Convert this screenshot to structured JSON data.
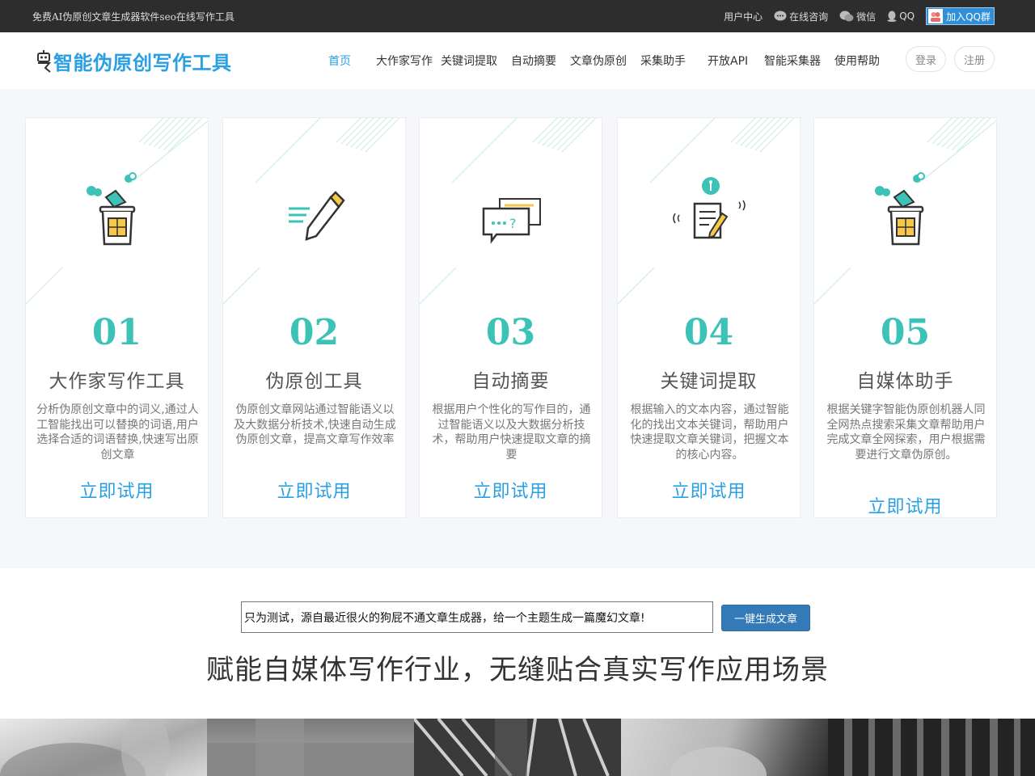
{
  "topbar": {
    "slogan": "免费AI伪原创文章生成器软件seo在线写作工具",
    "links": [
      {
        "label": "用户中心",
        "icon": "none"
      },
      {
        "label": "在线咨询",
        "icon": "chat-bubble-icon"
      },
      {
        "label": "微信",
        "icon": "wechat-icon"
      },
      {
        "label": "QQ",
        "icon": "qq-icon"
      }
    ],
    "qq_group": "加入QQ群"
  },
  "header": {
    "logo_text": "智能伪原创写作工具",
    "nav": [
      {
        "label": "首页",
        "active": true
      },
      {
        "label": "大作家写作",
        "active": false
      },
      {
        "label": "关键词提取",
        "active": false
      },
      {
        "label": "自动摘要",
        "active": false
      },
      {
        "label": "文章伪原创",
        "active": false
      },
      {
        "label": "采集助手",
        "active": false
      },
      {
        "label": "开放API",
        "active": false
      },
      {
        "label": "智能采集器",
        "active": false
      },
      {
        "label": "使用帮助",
        "active": false
      }
    ],
    "login": "登录",
    "register": "注册"
  },
  "cards": [
    {
      "num": "01",
      "title": "大作家写作工具",
      "desc": "分析伪原创文章中的词义,通过人工智能找出可以替换的词语,用户选择合适的词语替换,快速写出原创文章",
      "cta": "立即试用",
      "icon": "chip-bucket-icon"
    },
    {
      "num": "02",
      "title": "伪原创工具",
      "desc": "伪原创文章网站通过智能语义以及大数据分析技术,快速自动生成伪原创文章，提高文章写作效率",
      "cta": "立即试用",
      "icon": "pencil-icon"
    },
    {
      "num": "03",
      "title": "自动摘要",
      "desc": "根据用户个性化的写作目的，通过智能语义以及大数据分析技术，帮助用户快速提取文章的摘要",
      "cta": "立即试用",
      "icon": "chat-cards-icon"
    },
    {
      "num": "04",
      "title": "关键词提取",
      "desc": "根据输入的文本内容，通过智能化的找出文本关键词，帮助用户快速提取文章关键词，把握文本的核心内容。",
      "cta": "立即试用",
      "icon": "document-pen-icon"
    },
    {
      "num": "05",
      "title": "自媒体助手",
      "desc": "根据关键字智能伪原创机器人同全网热点搜索采集文章帮助用户完成文章全网探索，用户根据需要进行文章伪原创。",
      "cta": "立即试用",
      "icon": "chip-bucket-icon"
    }
  ],
  "generator": {
    "topic_value": "只为测试，源自最近很火的狗屁不通文章生成器，给一个主题生成一篇魔幻文章!",
    "button_label": "一键生成文章",
    "headline": "赋能自媒体写作行业，无缝贴合真实写作应用场景"
  },
  "colors": {
    "topbar_bg": "#2d2d2d",
    "brand_blue": "#2aa0e4",
    "teal_number": "#3cc2b6",
    "button_blue": "#337ab7"
  }
}
